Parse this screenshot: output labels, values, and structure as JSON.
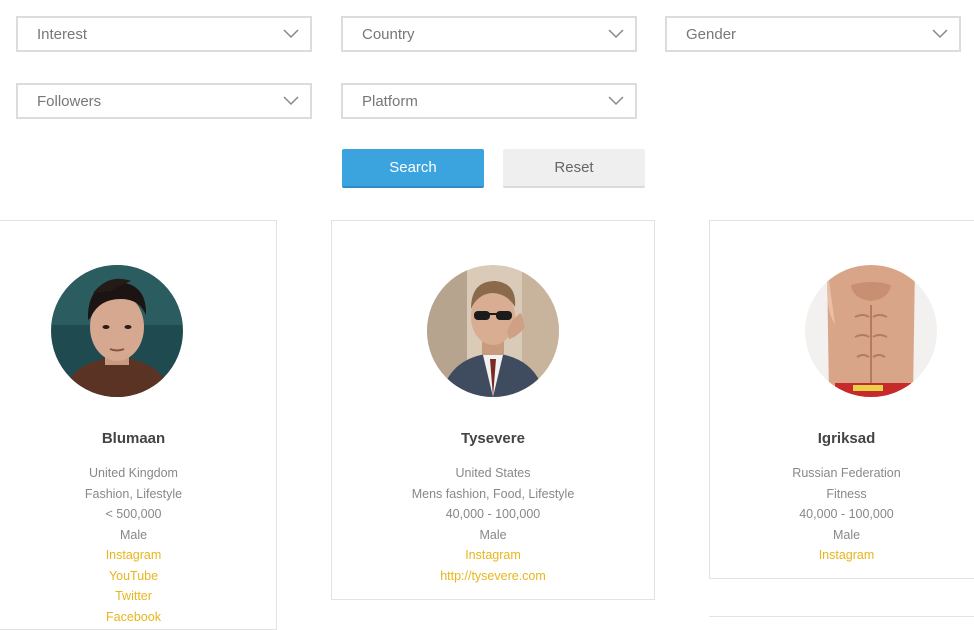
{
  "filters": {
    "interest": "Interest",
    "country": "Country",
    "gender": "Gender",
    "followers": "Followers",
    "platform": "Platform"
  },
  "buttons": {
    "search": "Search",
    "reset": "Reset"
  },
  "colors": {
    "primary": "#3ba3de",
    "link": "#e8b51c"
  },
  "cards": [
    {
      "name": "Blumaan",
      "country": "United Kingdom",
      "interests": "Fashion, Lifestyle",
      "followers": "< 500,000",
      "gender": "Male",
      "links": [
        "Instagram",
        "YouTube",
        "Twitter",
        "Facebook"
      ]
    },
    {
      "name": "Tysevere",
      "country": "United States",
      "interests": "Mens fashion, Food, Lifestyle",
      "followers": "40,000 - 100,000",
      "gender": "Male",
      "links": [
        "Instagram",
        "http://tysevere.com"
      ]
    },
    {
      "name": "Igriksad",
      "country": "Russian Federation",
      "interests": "Fitness",
      "followers": "40,000 - 100,000",
      "gender": "Male",
      "links": [
        "Instagram"
      ]
    }
  ]
}
